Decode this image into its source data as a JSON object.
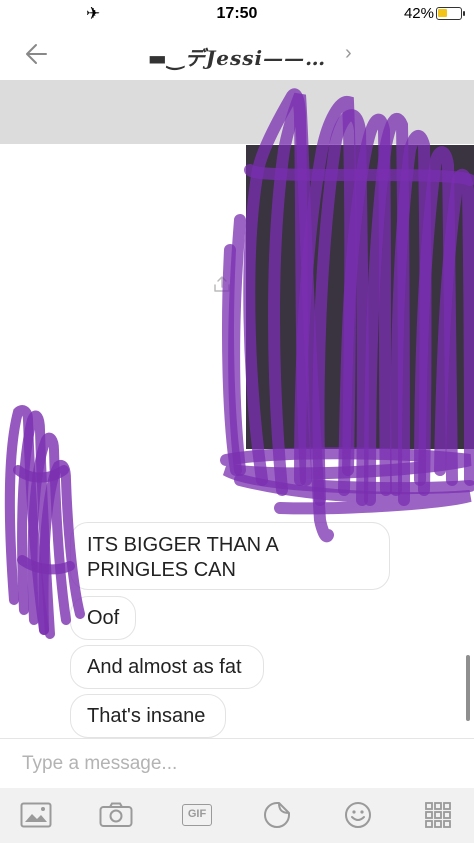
{
  "status_bar": {
    "time": "17:50",
    "battery_percent_label": "42%",
    "battery_level": 0.42,
    "airplane_icon": "airplane-icon"
  },
  "nav": {
    "back_icon": "back-arrow-icon",
    "title": "▬‿デJessi——…",
    "chevron_icon": "chevron-right-icon"
  },
  "photo": {
    "forward_icon": "forward-share-icon",
    "scribble_color": "#7a2fb0"
  },
  "messages": [
    {
      "text": "ITS BIGGER THAN A PRINGLES CAN"
    },
    {
      "text": "Oof"
    },
    {
      "text": "And almost as fat"
    },
    {
      "text": "That's insane"
    }
  ],
  "composer": {
    "placeholder": "Type a message..."
  },
  "toolbar": {
    "gallery_icon": "gallery-icon",
    "camera_icon": "camera-icon",
    "gif_label": "GIF",
    "sticker_icon": "sticker-icon",
    "emoji_icon": "emoji-icon",
    "more_icon": "grid-more-icon"
  }
}
